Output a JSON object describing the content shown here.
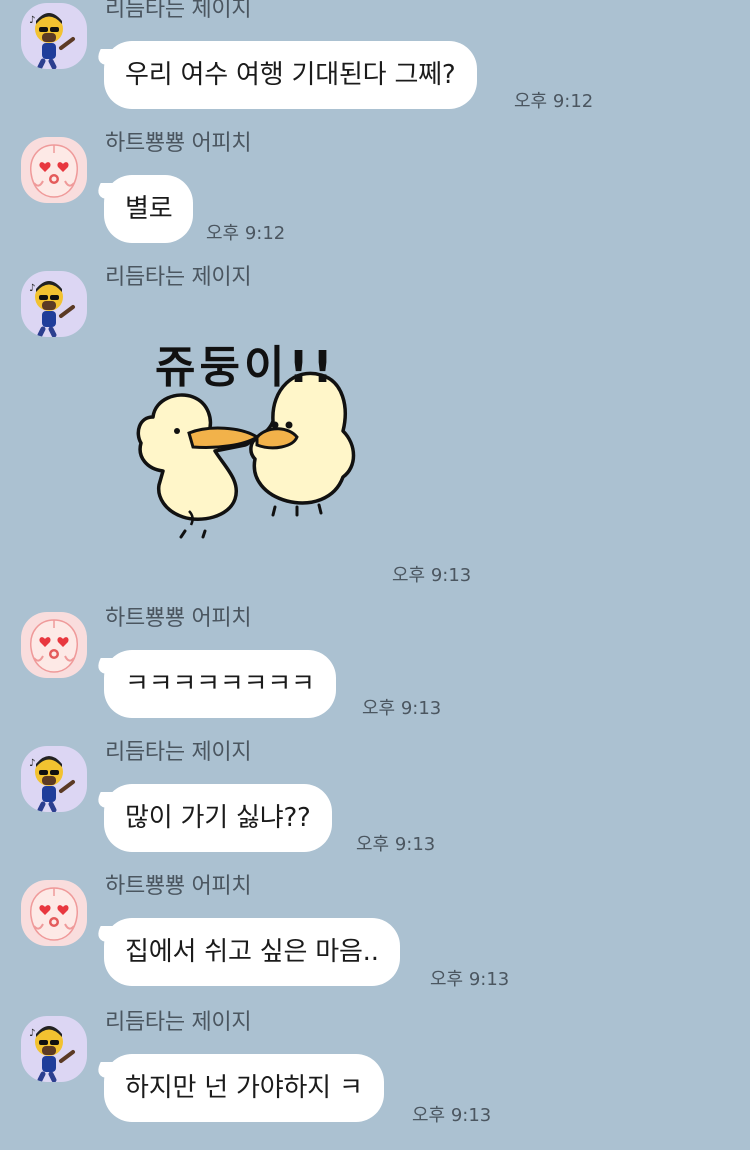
{
  "messages": [
    {
      "sender": "리듬타는 제이지",
      "avatar": "jay-g-avatar-icon",
      "text": "우리 여수 여행 기대된다 그쩨?",
      "time": "오후 9:12"
    },
    {
      "sender": "하트뿅뿅 어피치",
      "avatar": "apeach-avatar-icon",
      "text": "별로",
      "time": "오후 9:12"
    },
    {
      "sender": "리듬타는 제이지",
      "avatar": "jay-g-avatar-icon",
      "sticker_text": "쥬둥이!!",
      "sticker": "duck-sticker-icon",
      "time": "오후 9:13"
    },
    {
      "sender": "하트뿅뿅 어피치",
      "avatar": "apeach-avatar-icon",
      "text": "ㅋㅋㅋㅋㅋㅋㅋㅋ",
      "time": "오후 9:13"
    },
    {
      "sender": "리듬타는 제이지",
      "avatar": "jay-g-avatar-icon",
      "text": "많이 가기 싫냐??",
      "time": "오후 9:13"
    },
    {
      "sender": "하트뿅뿅 어피치",
      "avatar": "apeach-avatar-icon",
      "text": "집에서 쉬고 싶은 마음..",
      "time": "오후 9:13"
    },
    {
      "sender": "리듬타는 제이지",
      "avatar": "jay-g-avatar-icon",
      "text": "하지만 넌 가야하지 ㅋ",
      "time": "오후 9:13"
    }
  ],
  "colors": {
    "background": "#abc1d1",
    "bubble": "#ffffff",
    "jay_g_avatar_bg": "#dcd6f3",
    "apeach_avatar_bg": "#f9dddd"
  }
}
